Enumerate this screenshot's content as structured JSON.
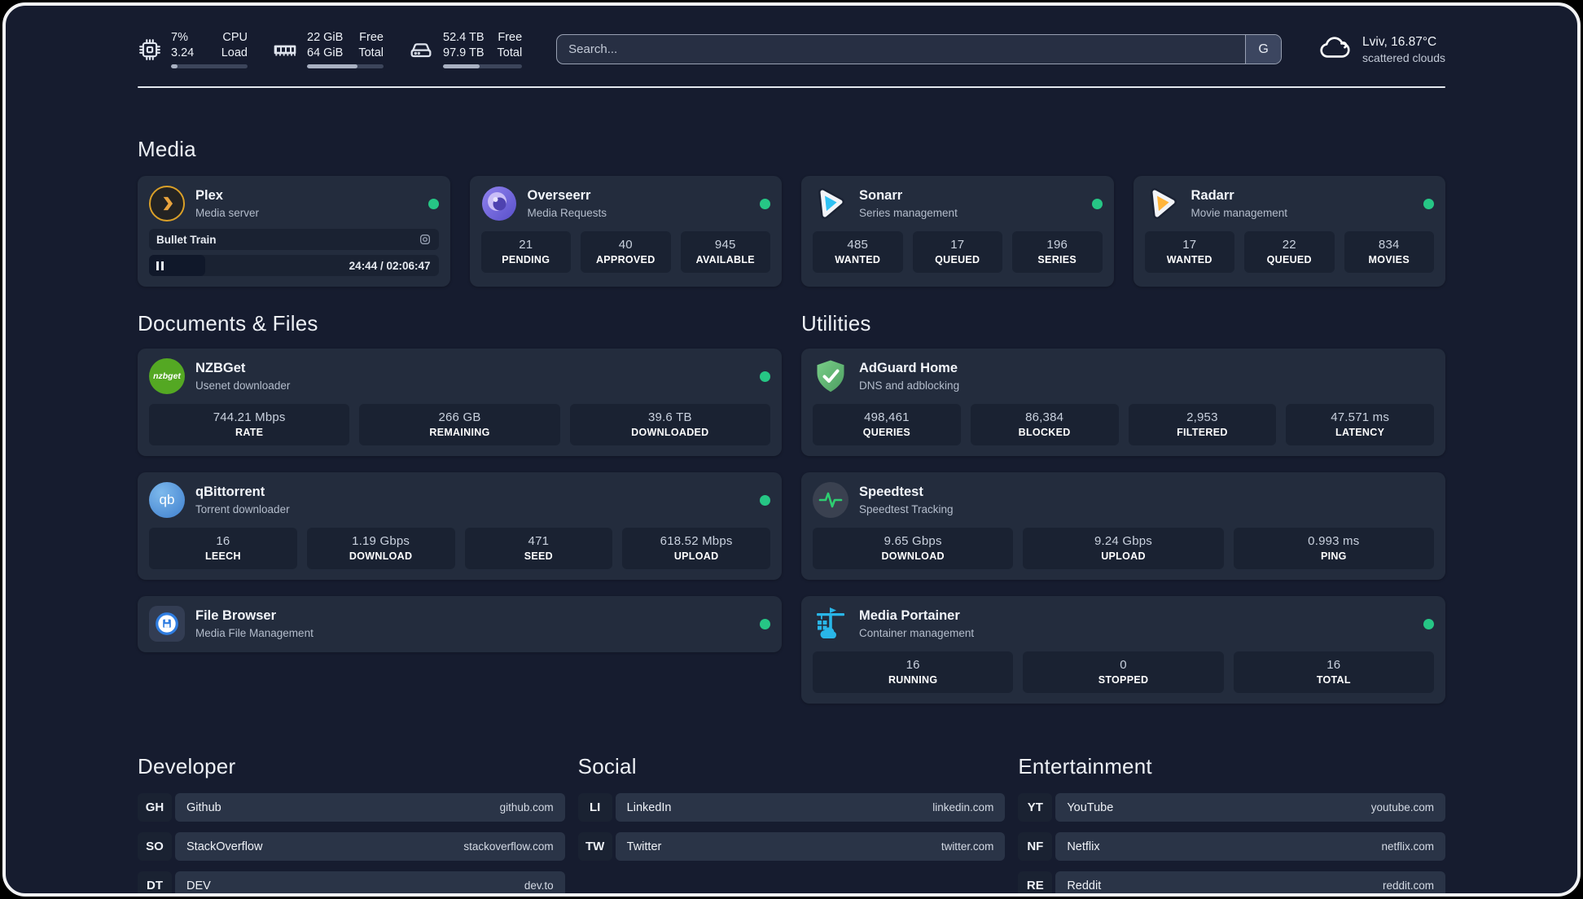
{
  "colors": {
    "background": "#161c2f",
    "card": "#232c3d",
    "pill": "#1a2232",
    "status_online": "#26c685",
    "plex": "#e8a33d",
    "overseerr": "#6760d6",
    "sonarr": "#2fc1f3",
    "radarr": "#ffb53c",
    "nzbget": "#54a823",
    "qbittorrent": "#4a90d9",
    "filebrowser": "#2f7de1",
    "adguard": "#68bc71",
    "speedtest_line": "#2ece71",
    "portainer": "#29b6e8"
  },
  "header": {
    "cpu": {
      "value_top": "7%",
      "value_bottom": "3.24",
      "label_top": "CPU",
      "label_bottom": "Load",
      "progress_percent": 8
    },
    "memory": {
      "value_top": "22 GiB",
      "value_bottom": "64 GiB",
      "label_top": "Free",
      "label_bottom": "Total",
      "progress_percent": 66
    },
    "storage": {
      "value_top": "52.4 TB",
      "value_bottom": "97.9 TB",
      "label_top": "Free",
      "label_bottom": "Total",
      "progress_percent": 46
    },
    "search": {
      "placeholder": "Search...",
      "engine_label": "G"
    },
    "weather": {
      "location": "Lviv, 16.87°C",
      "condition": "scattered clouds"
    }
  },
  "sections": {
    "media": {
      "title": "Media",
      "plex": {
        "name": "Plex",
        "subtitle": "Media server",
        "now_playing": {
          "title": "Bullet Train",
          "time": "24:44 / 02:06:47",
          "progress_percent": 19.5
        }
      },
      "overseerr": {
        "name": "Overseerr",
        "subtitle": "Media Requests",
        "stats": [
          {
            "value": "21",
            "label": "PENDING"
          },
          {
            "value": "40",
            "label": "APPROVED"
          },
          {
            "value": "945",
            "label": "AVAILABLE"
          }
        ]
      },
      "sonarr": {
        "name": "Sonarr",
        "subtitle": "Series management",
        "stats": [
          {
            "value": "485",
            "label": "WANTED"
          },
          {
            "value": "17",
            "label": "QUEUED"
          },
          {
            "value": "196",
            "label": "SERIES"
          }
        ]
      },
      "radarr": {
        "name": "Radarr",
        "subtitle": "Movie management",
        "stats": [
          {
            "value": "17",
            "label": "WANTED"
          },
          {
            "value": "22",
            "label": "QUEUED"
          },
          {
            "value": "834",
            "label": "MOVIES"
          }
        ]
      }
    },
    "documents": {
      "title": "Documents & Files",
      "nzbget": {
        "name": "NZBGet",
        "subtitle": "Usenet downloader",
        "icon_text": "nzbget",
        "stats": [
          {
            "value": "744.21 Mbps",
            "label": "RATE"
          },
          {
            "value": "266 GB",
            "label": "REMAINING"
          },
          {
            "value": "39.6 TB",
            "label": "DOWNLOADED"
          }
        ]
      },
      "qbittorrent": {
        "name": "qBittorrent",
        "subtitle": "Torrent downloader",
        "icon_text": "qb",
        "stats": [
          {
            "value": "16",
            "label": "LEECH"
          },
          {
            "value": "1.19 Gbps",
            "label": "DOWNLOAD"
          },
          {
            "value": "471",
            "label": "SEED"
          },
          {
            "value": "618.52 Mbps",
            "label": "UPLOAD"
          }
        ]
      },
      "filebrowser": {
        "name": "File Browser",
        "subtitle": "Media File Management"
      }
    },
    "utilities": {
      "title": "Utilities",
      "adguard": {
        "name": "AdGuard Home",
        "subtitle": "DNS and adblocking",
        "stats": [
          {
            "value": "498,461",
            "label": "QUERIES"
          },
          {
            "value": "86,384",
            "label": "BLOCKED"
          },
          {
            "value": "2,953",
            "label": "FILTERED"
          },
          {
            "value": "47.571 ms",
            "label": "LATENCY"
          }
        ]
      },
      "speedtest": {
        "name": "Speedtest",
        "subtitle": "Speedtest Tracking",
        "stats": [
          {
            "value": "9.65 Gbps",
            "label": "DOWNLOAD"
          },
          {
            "value": "9.24 Gbps",
            "label": "UPLOAD"
          },
          {
            "value": "0.993 ms",
            "label": "PING"
          }
        ]
      },
      "portainer": {
        "name": "Media Portainer",
        "subtitle": "Container management",
        "stats": [
          {
            "value": "16",
            "label": "RUNNING"
          },
          {
            "value": "0",
            "label": "STOPPED"
          },
          {
            "value": "16",
            "label": "TOTAL"
          }
        ]
      }
    },
    "developer": {
      "title": "Developer",
      "links": [
        {
          "abbr": "GH",
          "name": "Github",
          "url": "github.com"
        },
        {
          "abbr": "SO",
          "name": "StackOverflow",
          "url": "stackoverflow.com"
        },
        {
          "abbr": "DT",
          "name": "DEV",
          "url": "dev.to"
        }
      ]
    },
    "social": {
      "title": "Social",
      "links": [
        {
          "abbr": "LI",
          "name": "LinkedIn",
          "url": "linkedin.com"
        },
        {
          "abbr": "TW",
          "name": "Twitter",
          "url": "twitter.com"
        }
      ]
    },
    "entertainment": {
      "title": "Entertainment",
      "links": [
        {
          "abbr": "YT",
          "name": "YouTube",
          "url": "youtube.com"
        },
        {
          "abbr": "NF",
          "name": "Netflix",
          "url": "netflix.com"
        },
        {
          "abbr": "RE",
          "name": "Reddit",
          "url": "reddit.com"
        }
      ]
    }
  }
}
